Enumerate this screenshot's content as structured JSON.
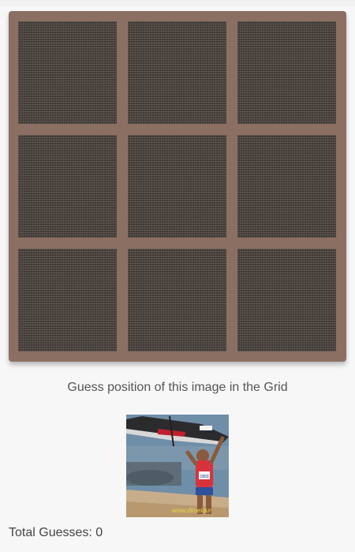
{
  "game": {
    "prompt": "Guess position of this image in the Grid",
    "total_guesses_label": "Total Guesses: 0",
    "total_guesses": 0,
    "watermark": "www.dimeldur",
    "bib_number": "1803"
  },
  "grid": {
    "rows": 3,
    "cols": 3,
    "tiles": [
      "tile-1",
      "tile-2",
      "tile-3",
      "tile-4",
      "tile-5",
      "tile-6",
      "tile-7",
      "tile-8",
      "tile-9"
    ]
  },
  "colors": {
    "board": "#8c6f63",
    "tile": "#3d3a37",
    "background": "#f7f7f7"
  }
}
